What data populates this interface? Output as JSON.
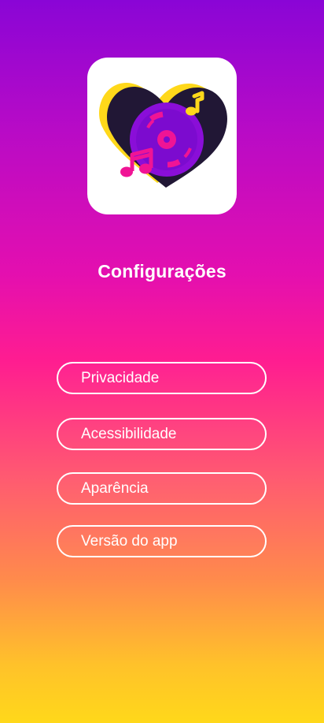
{
  "app": {
    "logo_icon": "heart-vinyl-music-logo",
    "colors": {
      "gradient_top": "#8a05d6",
      "gradient_middle": "#ff1d90",
      "gradient_bottom": "#ffd81a",
      "logo_heart": "#211735",
      "logo_shadow": "#ffd81a",
      "logo_record": "#8a0ed8",
      "logo_accent": "#f01495"
    }
  },
  "page": {
    "title": "Configurações"
  },
  "menu": {
    "items": [
      {
        "label": "Privacidade"
      },
      {
        "label": "Acessibilidade"
      },
      {
        "label": "Aparência"
      },
      {
        "label": "Versão do app"
      }
    ]
  }
}
